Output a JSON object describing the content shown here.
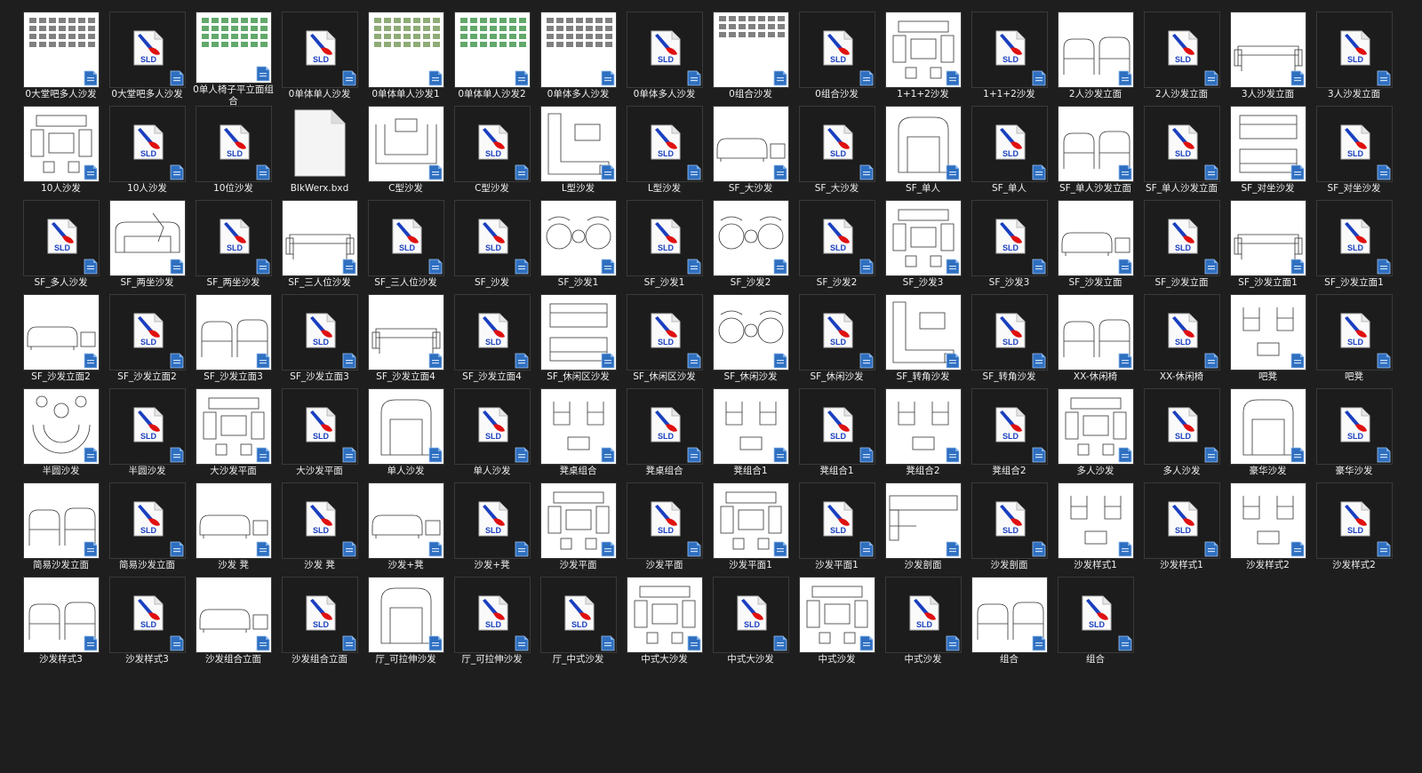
{
  "items": [
    {
      "name": "0大堂吧多人沙发",
      "kind": "drawing",
      "art": "grid-dense"
    },
    {
      "name": "0大堂吧多人沙发",
      "kind": "sld"
    },
    {
      "name": "0单人椅子平立面组合",
      "kind": "drawing",
      "art": "grid-green"
    },
    {
      "name": "0单体单人沙发",
      "kind": "sld"
    },
    {
      "name": "0单体单人沙发1",
      "kind": "drawing",
      "art": "grid-green-light"
    },
    {
      "name": "0单体单人沙发2",
      "kind": "drawing",
      "art": "grid-green"
    },
    {
      "name": "0单体多人沙发",
      "kind": "drawing",
      "art": "grid-dense"
    },
    {
      "name": "0单体多人沙发",
      "kind": "sld"
    },
    {
      "name": "0组合沙发",
      "kind": "drawing",
      "art": "grid-strip"
    },
    {
      "name": "0组合沙发",
      "kind": "sld"
    },
    {
      "name": "1+1+2沙发",
      "kind": "drawing",
      "art": "plan-set"
    },
    {
      "name": "1+1+2沙发",
      "kind": "sld"
    },
    {
      "name": "2人沙发立面",
      "kind": "drawing",
      "art": "chairs-elev"
    },
    {
      "name": "2人沙发立面",
      "kind": "sld"
    },
    {
      "name": "3人沙发立面",
      "kind": "drawing",
      "art": "sofa-elev"
    },
    {
      "name": "3人沙发立面",
      "kind": "sld"
    },
    {
      "name": "10人沙发",
      "kind": "drawing",
      "art": "plan-set"
    },
    {
      "name": "10人沙发",
      "kind": "sld"
    },
    {
      "name": "10位沙发",
      "kind": "sld"
    },
    {
      "name": "BlkWerx.bxd",
      "kind": "bxd"
    },
    {
      "name": "C型沙发",
      "kind": "drawing",
      "art": "c-sofa"
    },
    {
      "name": "C型沙发",
      "kind": "sld"
    },
    {
      "name": "L型沙发",
      "kind": "drawing",
      "art": "l-sofa"
    },
    {
      "name": "L型沙发",
      "kind": "sld"
    },
    {
      "name": "SF_大沙发",
      "kind": "drawing",
      "art": "sofa-row"
    },
    {
      "name": "SF_大沙发",
      "kind": "sld"
    },
    {
      "name": "SF_单人",
      "kind": "drawing",
      "art": "armchair"
    },
    {
      "name": "SF_单人",
      "kind": "sld"
    },
    {
      "name": "SF_单人沙发立面",
      "kind": "drawing",
      "art": "chairs-elev"
    },
    {
      "name": "SF_单人沙发立面",
      "kind": "sld"
    },
    {
      "name": "SF_对坐沙发",
      "kind": "drawing",
      "art": "facing"
    },
    {
      "name": "SF_对坐沙发",
      "kind": "sld"
    },
    {
      "name": "SF_多人沙发",
      "kind": "sld"
    },
    {
      "name": "SF_两坐沙发",
      "kind": "drawing",
      "art": "loveseat"
    },
    {
      "name": "SF_两坐沙发",
      "kind": "sld"
    },
    {
      "name": "SF_三人位沙发",
      "kind": "drawing",
      "art": "sofa-elev"
    },
    {
      "name": "SF_三人位沙发",
      "kind": "sld"
    },
    {
      "name": "SF_沙发",
      "kind": "sld"
    },
    {
      "name": "SF_沙发1",
      "kind": "drawing",
      "art": "pair-round"
    },
    {
      "name": "SF_沙发1",
      "kind": "sld"
    },
    {
      "name": "SF_沙发2",
      "kind": "drawing",
      "art": "pair-round"
    },
    {
      "name": "SF_沙发2",
      "kind": "sld"
    },
    {
      "name": "SF_沙发3",
      "kind": "drawing",
      "art": "plan-set"
    },
    {
      "name": "SF_沙发3",
      "kind": "sld"
    },
    {
      "name": "SF_沙发立面",
      "kind": "drawing",
      "art": "sofa-row"
    },
    {
      "name": "SF_沙发立面",
      "kind": "sld"
    },
    {
      "name": "SF_沙发立面1",
      "kind": "drawing",
      "art": "sofa-elev"
    },
    {
      "name": "SF_沙发立面1",
      "kind": "sld"
    },
    {
      "name": "SF_沙发立面2",
      "kind": "drawing",
      "art": "sofa-row"
    },
    {
      "name": "SF_沙发立面2",
      "kind": "sld"
    },
    {
      "name": "SF_沙发立面3",
      "kind": "drawing",
      "art": "chairs-elev"
    },
    {
      "name": "SF_沙发立面3",
      "kind": "sld"
    },
    {
      "name": "SF_沙发立面4",
      "kind": "drawing",
      "art": "sofa-elev"
    },
    {
      "name": "SF_沙发立面4",
      "kind": "sld"
    },
    {
      "name": "SF_休闲区沙发",
      "kind": "drawing",
      "art": "facing"
    },
    {
      "name": "SF_休闲区沙发",
      "kind": "sld"
    },
    {
      "name": "SF_休闲沙发",
      "kind": "drawing",
      "art": "pair-round"
    },
    {
      "name": "SF_休闲沙发",
      "kind": "sld"
    },
    {
      "name": "SF_转角沙发",
      "kind": "drawing",
      "art": "l-sofa"
    },
    {
      "name": "SF_转角沙发",
      "kind": "sld"
    },
    {
      "name": "XX-休闲椅",
      "kind": "drawing",
      "art": "chairs-elev"
    },
    {
      "name": "XX-休闲椅",
      "kind": "sld"
    },
    {
      "name": "吧凳",
      "kind": "drawing",
      "art": "stools"
    },
    {
      "name": "吧凳",
      "kind": "sld"
    },
    {
      "name": "半圆沙发",
      "kind": "drawing",
      "art": "round-sofa"
    },
    {
      "name": "半圆沙发",
      "kind": "sld"
    },
    {
      "name": "大沙发平面",
      "kind": "drawing",
      "art": "plan-set"
    },
    {
      "name": "大沙发平面",
      "kind": "sld"
    },
    {
      "name": "单人沙发",
      "kind": "drawing",
      "art": "armchair"
    },
    {
      "name": "单人沙发",
      "kind": "sld"
    },
    {
      "name": "凳桌组合",
      "kind": "drawing",
      "art": "stools"
    },
    {
      "name": "凳桌组合",
      "kind": "sld"
    },
    {
      "name": "凳组合1",
      "kind": "drawing",
      "art": "stools"
    },
    {
      "name": "凳组合1",
      "kind": "sld"
    },
    {
      "name": "凳组合2",
      "kind": "drawing",
      "art": "stools"
    },
    {
      "name": "凳组合2",
      "kind": "sld"
    },
    {
      "name": "多人沙发",
      "kind": "drawing",
      "art": "plan-set"
    },
    {
      "name": "多人沙发",
      "kind": "sld"
    },
    {
      "name": "豪华沙发",
      "kind": "drawing",
      "art": "armchair"
    },
    {
      "name": "豪华沙发",
      "kind": "sld"
    },
    {
      "name": "简易沙发立面",
      "kind": "drawing",
      "art": "chairs-elev"
    },
    {
      "name": "简易沙发立面",
      "kind": "sld"
    },
    {
      "name": "沙发 凳",
      "kind": "drawing",
      "art": "sofa-row"
    },
    {
      "name": "沙发 凳",
      "kind": "sld"
    },
    {
      "name": "沙发+凳",
      "kind": "drawing",
      "art": "sofa-row"
    },
    {
      "name": "沙发+凳",
      "kind": "sld"
    },
    {
      "name": "沙发平面",
      "kind": "drawing",
      "art": "plan-set"
    },
    {
      "name": "沙发平面",
      "kind": "sld"
    },
    {
      "name": "沙发平面1",
      "kind": "drawing",
      "art": "plan-set"
    },
    {
      "name": "沙发平面1",
      "kind": "sld"
    },
    {
      "name": "沙发剖面",
      "kind": "drawing",
      "art": "section"
    },
    {
      "name": "沙发剖面",
      "kind": "sld"
    },
    {
      "name": "沙发样式1",
      "kind": "drawing",
      "art": "stools"
    },
    {
      "name": "沙发样式1",
      "kind": "sld"
    },
    {
      "name": "沙发样式2",
      "kind": "drawing",
      "art": "stools"
    },
    {
      "name": "沙发样式2",
      "kind": "sld"
    },
    {
      "name": "沙发样式3",
      "kind": "drawing",
      "art": "chairs-elev"
    },
    {
      "name": "沙发样式3",
      "kind": "sld"
    },
    {
      "name": "沙发组合立面",
      "kind": "drawing",
      "art": "sofa-row"
    },
    {
      "name": "沙发组合立面",
      "kind": "sld"
    },
    {
      "name": "厅_可拉伸沙发",
      "kind": "drawing",
      "art": "armchair"
    },
    {
      "name": "厅_可拉伸沙发",
      "kind": "sld"
    },
    {
      "name": "厅_中式沙发",
      "kind": "sld"
    },
    {
      "name": "中式大沙发",
      "kind": "drawing",
      "art": "plan-set"
    },
    {
      "name": "中式大沙发",
      "kind": "sld"
    },
    {
      "name": "中式沙发",
      "kind": "drawing",
      "art": "plan-set"
    },
    {
      "name": "中式沙发",
      "kind": "sld"
    },
    {
      "name": "组合",
      "kind": "drawing",
      "art": "chairs-elev"
    },
    {
      "name": "组合",
      "kind": "sld"
    }
  ],
  "icons": {
    "sld_label": "SLD",
    "sld_color": "#1a3fbf",
    "sld_accent": "#e01010",
    "badge_color": "#2f6fc0"
  }
}
